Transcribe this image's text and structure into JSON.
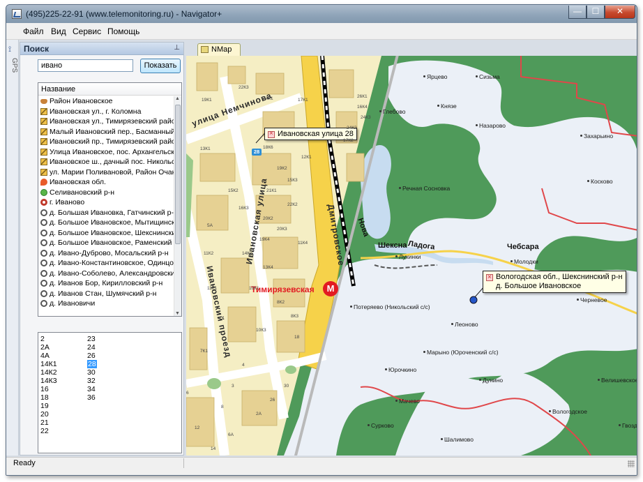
{
  "window": {
    "title": "(495)225-22-91  (www.telemonitoring.ru) - Navigator+",
    "minimize_glyph": "—",
    "maximize_glyph": "☐",
    "close_glyph": "✕"
  },
  "menu": {
    "items": [
      {
        "label": "Файл"
      },
      {
        "label": "Вид"
      },
      {
        "label": "Сервис"
      },
      {
        "label": "Помощь"
      }
    ]
  },
  "side_tabs": {
    "gps_label": "GPS",
    "icon": "gps-antenna-icon"
  },
  "search_panel": {
    "title": "Поиск",
    "pin_glyph": "⊥",
    "query_value": "ивано",
    "show_button_label": "Показать",
    "column_header": "Название",
    "results": [
      {
        "label": "Район Ивановское",
        "icon": "district-icon"
      },
      {
        "label": "Ивановская ул., г. Коломна",
        "icon": "street-icon"
      },
      {
        "label": "Ивановская ул., Тимирязевский район",
        "icon": "street-icon"
      },
      {
        "label": "Малый Ивановский пер., Басманный р-н",
        "icon": "street-icon"
      },
      {
        "label": "Ивановский пр., Тимирязевский район",
        "icon": "street-icon"
      },
      {
        "label": "Улица Ивановское, пос. Архангельское",
        "icon": "street-icon"
      },
      {
        "label": "Ивановское ш., дачный пос. Никольское",
        "icon": "street-icon"
      },
      {
        "label": "ул. Марии Поливановой, Район Очаково",
        "icon": "street-icon"
      },
      {
        "label": "Ивановская обл.",
        "icon": "region-icon"
      },
      {
        "label": "Селивановский р-н",
        "icon": "area-icon"
      },
      {
        "label": "г. Иваново",
        "icon": "city-icon"
      },
      {
        "label": "д. Большая Ивановка, Гатчинский р-н",
        "icon": "village-icon"
      },
      {
        "label": "д. Большое Ивановское, Мытищинский р-н",
        "icon": "village-icon"
      },
      {
        "label": "д. Большое Ивановское, Шекснинский р-н",
        "icon": "village-icon"
      },
      {
        "label": "д. Большое Ивановское, Раменский р-н",
        "icon": "village-icon"
      },
      {
        "label": "д. Ивано-Дуброво, Мосальский р-н",
        "icon": "village-icon"
      },
      {
        "label": "д. Ивано-Константиновское, Одинцовский р-н",
        "icon": "village-icon"
      },
      {
        "label": "д. Ивано-Соболево, Александровский р-н",
        "icon": "village-icon"
      },
      {
        "label": "д. Иванов Бор, Кирилловский р-н",
        "icon": "village-icon"
      },
      {
        "label": "д. Иванов Стан, Шумячский р-н",
        "icon": "village-icon"
      },
      {
        "label": "д. Ивановичи",
        "icon": "village-icon"
      }
    ],
    "houses_col1": [
      "2",
      "2А",
      "4А",
      "14К1",
      "14К2",
      "14К3",
      "16",
      "18",
      "19",
      "20",
      "21",
      "22"
    ],
    "houses_col2": [
      "23",
      "24",
      "26",
      "28",
      "30",
      "32",
      "34",
      "36"
    ],
    "selected_house": "28"
  },
  "map_tab": {
    "label": "NMap",
    "icon": "map-tab-icon"
  },
  "city_map": {
    "streets": {
      "nemchinova": "улица Немчинова",
      "ivanovskaya": "Ивановская улица",
      "ivanovskiy_proezd": "Ивановский проезд",
      "dmitrovskoe": "Дмитровское"
    },
    "metro": {
      "name": "Тимирязевская",
      "glyph": "M"
    },
    "callout_text": "Ивановская улица 28",
    "marker_number": "28",
    "buildings": [
      "19К1",
      "22К3",
      "24К1",
      "17К1",
      "26К1",
      "16К4",
      "24К3",
      "24К2",
      "17К2",
      "12К1",
      "13К1",
      "18К6",
      "19К2",
      "21К1",
      "15К3",
      "15К2",
      "16К3",
      "20К2",
      "20К3",
      "22К2",
      "19К4",
      "5А",
      "11К2",
      "14К2",
      "11К4",
      "13К4",
      "10К1",
      "11К1",
      "8К2",
      "8К3",
      "10К3",
      "7К1",
      "4",
      "6",
      "8",
      "2А",
      "6А",
      "14",
      "30",
      "3",
      "26",
      "12",
      "18"
    ]
  },
  "region_map": {
    "places": [
      "Ярцево",
      "Сизьма",
      "Глебово",
      "Князе",
      "Назарово",
      "Захарьино",
      "Косково",
      "Речная Сосновка",
      "Лукинки",
      "Молодки",
      "Черневое",
      "Потеряево (Никольский с/с)",
      "Леоново",
      "Марыно (Юроченский с/с)",
      "Юрочкино",
      "Дунино",
      "Мачево",
      "Сурково",
      "Шалимово",
      "Вологодское",
      "Гвоздево",
      "Велишевское"
    ],
    "big_places": {
      "cheksna": "Шексна",
      "chebsara": "Чебсара",
      "nova": "Нова",
      "sheksna_water": "Ладога"
    },
    "callout_line1": "Вологодская обл., Шекснинский р-н",
    "callout_line2": "д. Большое Ивановское"
  },
  "status": {
    "text": "Ready"
  },
  "colors": {
    "water": "#c7dcf0",
    "forest": "#4f9a5a",
    "field": "#ebf0f7",
    "city_bg": "#f5eec4",
    "block": "#e6d193",
    "road": "#ffffff",
    "highway": "#f6d24a",
    "border": "#e0474a"
  }
}
